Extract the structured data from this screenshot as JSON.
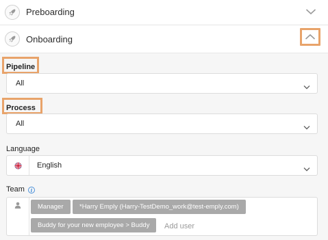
{
  "steps": [
    {
      "label": "Preboarding",
      "icon": "rocket-icon",
      "expanded": false
    },
    {
      "label": "Onboarding",
      "icon": "rocket-icon",
      "expanded": true
    }
  ],
  "pipeline": {
    "label": "Pipeline",
    "value": "All"
  },
  "process": {
    "label": "Process",
    "value": "All"
  },
  "language": {
    "label": "Language",
    "value": "English",
    "flag": "uk-flag-icon"
  },
  "team": {
    "label": "Team",
    "tags": [
      "Manager",
      "*Harry Emply (Harry-TestDemo_work@test-emply.com)",
      "Buddy for your new employee > Buddy"
    ],
    "add_placeholder": "Add user"
  },
  "colors": {
    "highlight": "#e8a36a",
    "info": "#4a90d9",
    "tag_bg": "#a9a9a9"
  }
}
